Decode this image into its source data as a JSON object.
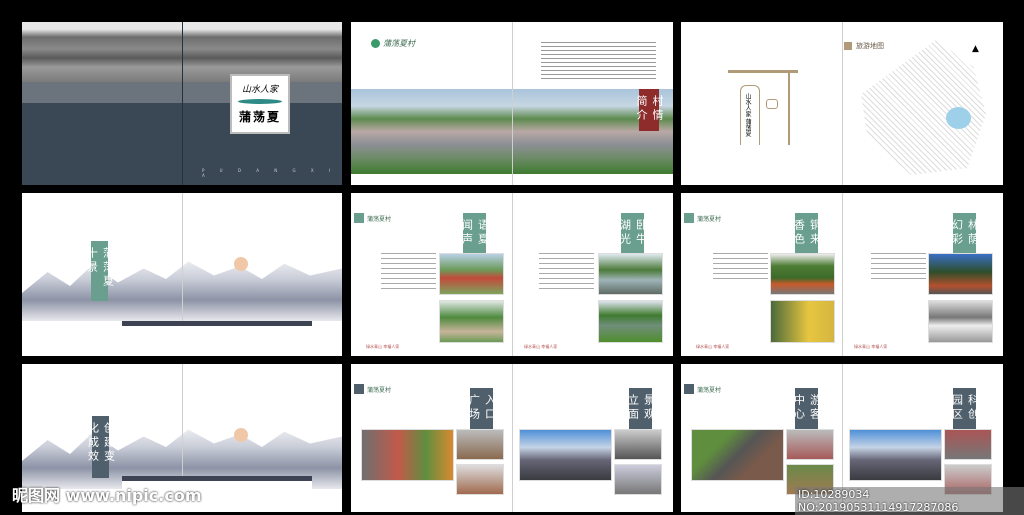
{
  "cover": {
    "badge_top": "山水人家",
    "badge_title": "蒲荡夏",
    "letters": "P U D A N G X I A"
  },
  "intro": {
    "logo": "蒲荡夏村",
    "section": "村情简介"
  },
  "map": {
    "gate_title": "山水人家 蒲荡夏",
    "section": "旅游地图"
  },
  "divider1": {
    "section": "蒲荡夏十景"
  },
  "scenic1": {
    "logo": "蒲荡夏村",
    "left_title": "语夏闻声",
    "right_title": "卧牛湖光"
  },
  "scenic2": {
    "logo": "蒲荡夏村",
    "left_title": "铜来香色",
    "right_title": "林荫幻彩"
  },
  "divider2": {
    "section": "创建变化成效"
  },
  "change1": {
    "logo": "蒲荡夏村",
    "left_title": "入口广场",
    "right_title": "景观立面"
  },
  "change2": {
    "logo": "蒲荡夏村",
    "left_title": "游客中心",
    "right_title": "科创园区"
  },
  "footer_slogan": "绿水青山 幸福人家",
  "watermark": {
    "left": "昵图网 www.nipic.com",
    "right": "ID:10289034 NO:20190531114917287086"
  }
}
